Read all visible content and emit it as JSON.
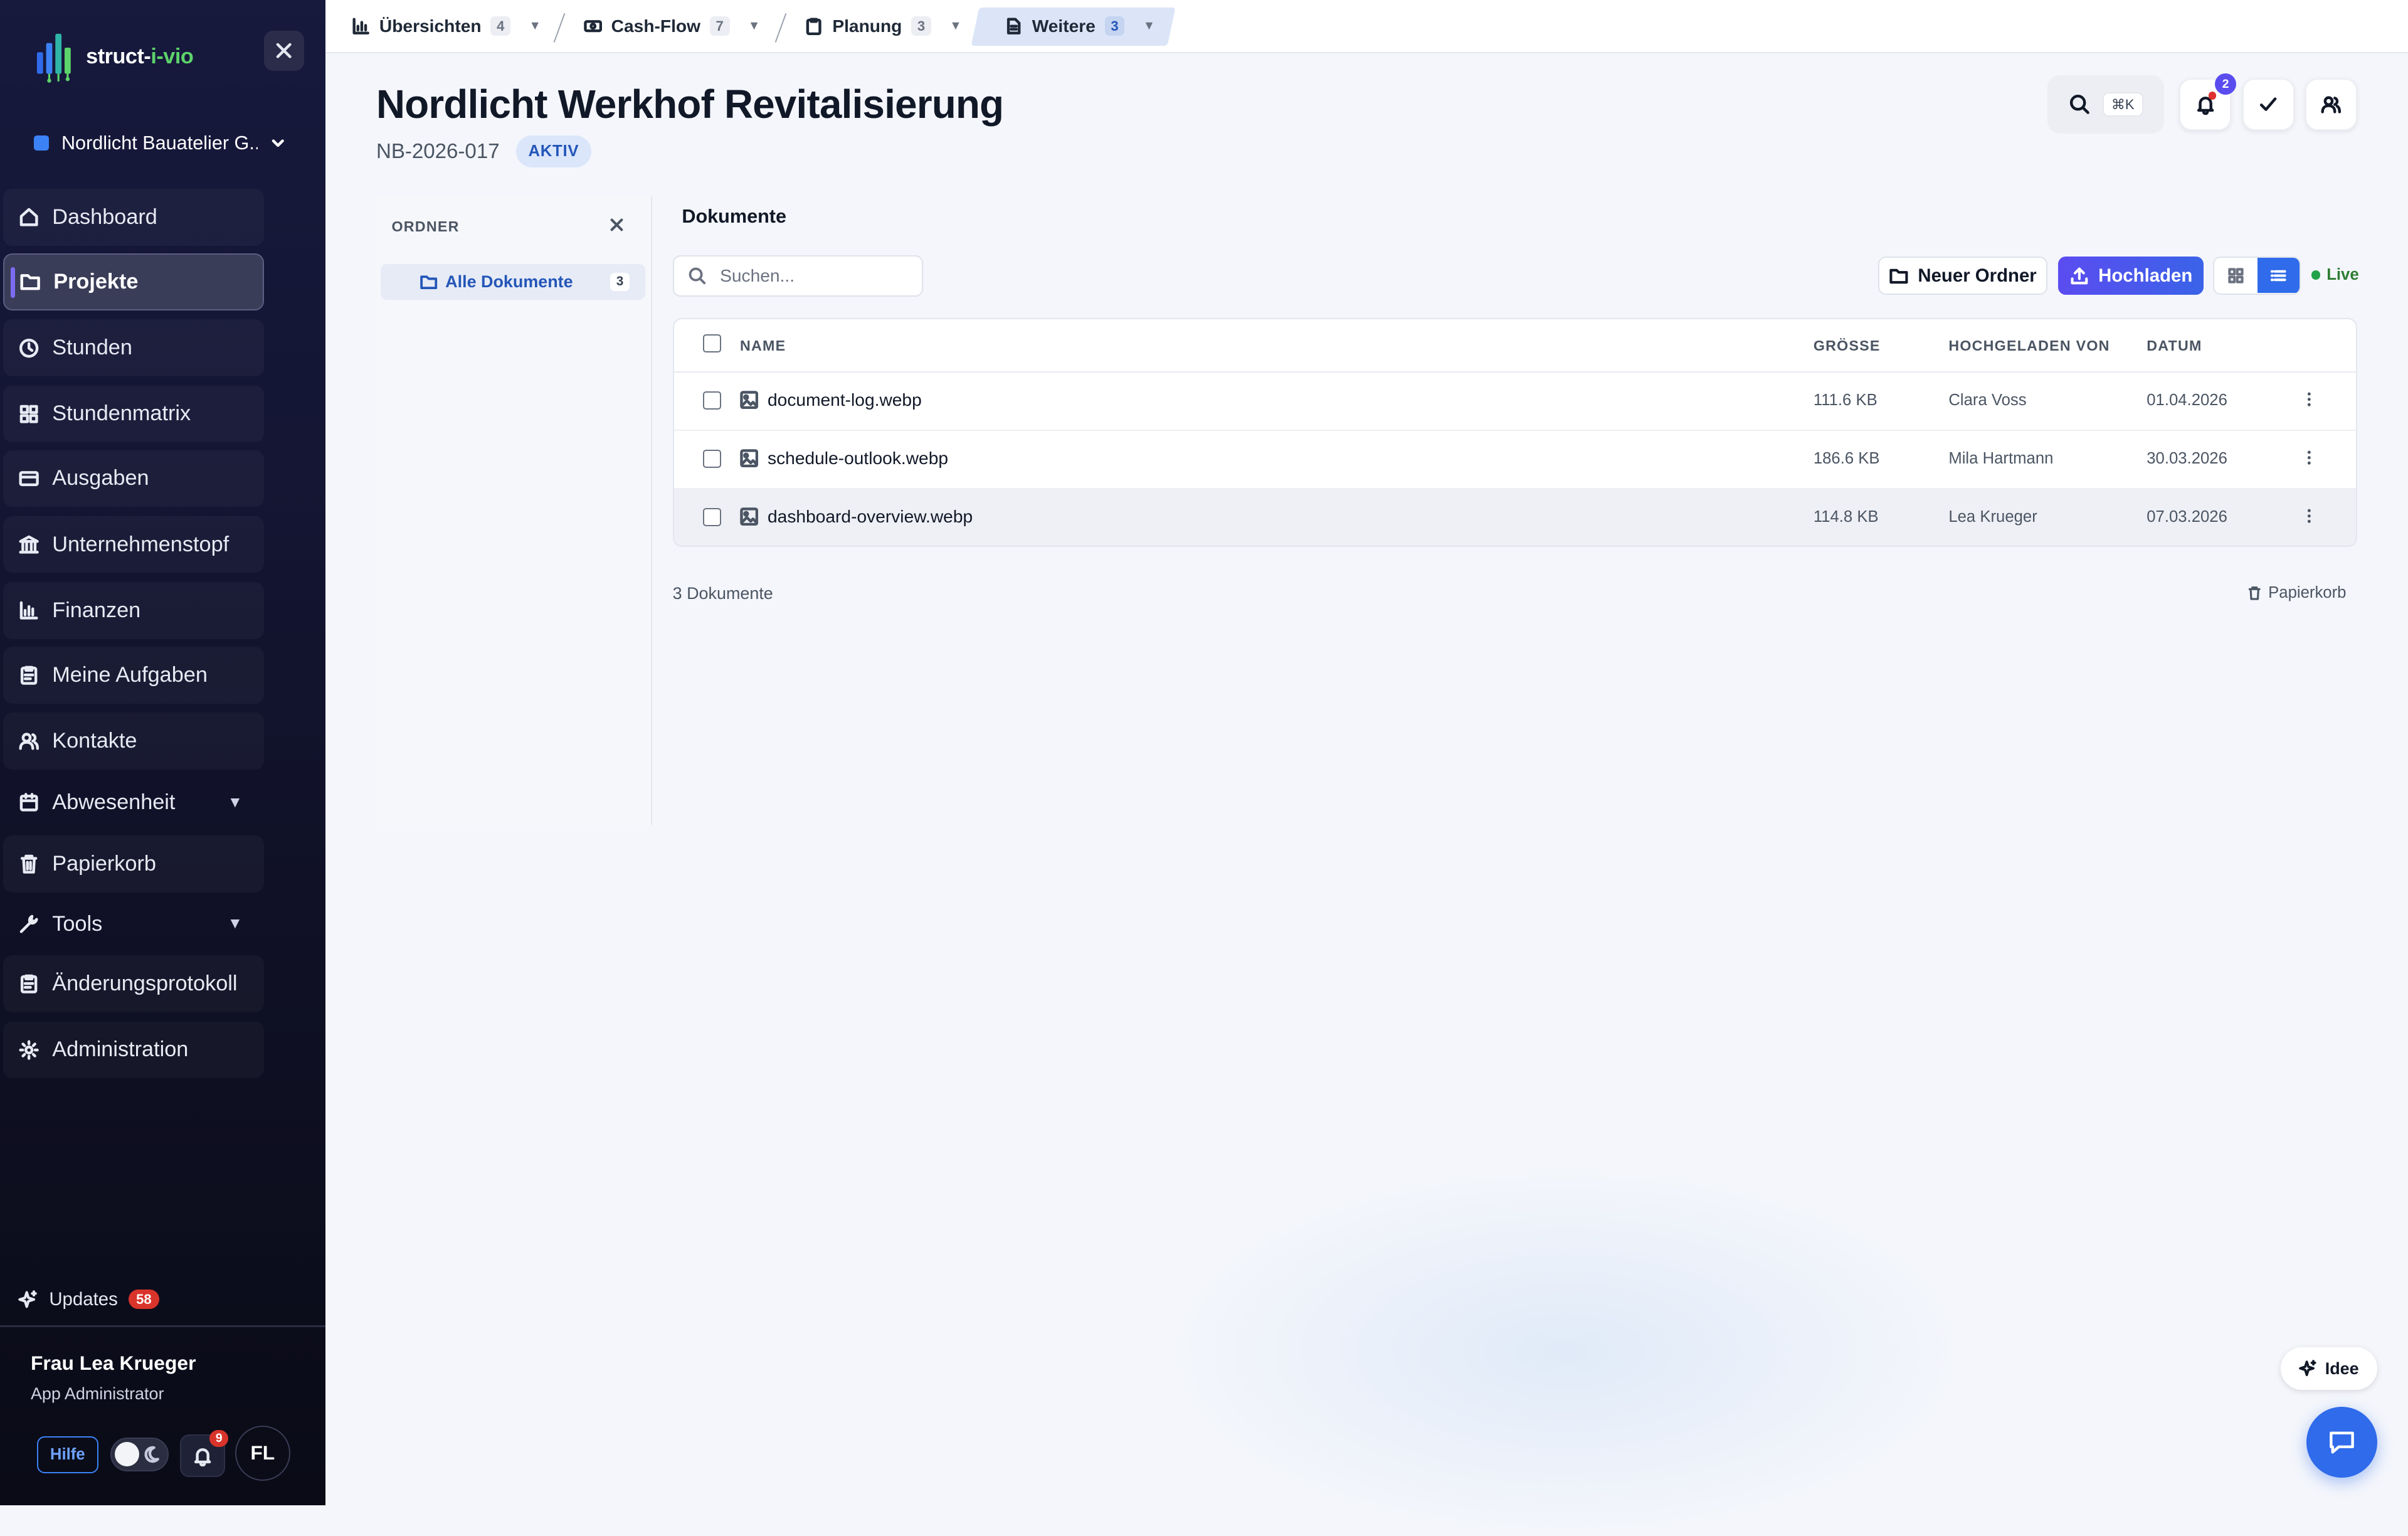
{
  "app": {
    "logo_text_main": "struct-",
    "logo_text_accent": "i-vio",
    "company": "Nordlicht Bauatelier G..."
  },
  "sidebar": {
    "items": [
      {
        "label": "Dashboard",
        "icon": "home-icon"
      },
      {
        "label": "Projekte",
        "icon": "folder-icon",
        "active": true
      },
      {
        "label": "Stunden",
        "icon": "clock-icon"
      },
      {
        "label": "Stundenmatrix",
        "icon": "grid-icon"
      },
      {
        "label": "Ausgaben",
        "icon": "card-icon"
      },
      {
        "label": "Unternehmenstopf",
        "icon": "bank-icon"
      },
      {
        "label": "Finanzen",
        "icon": "chart-icon"
      },
      {
        "label": "Meine Aufgaben",
        "icon": "clipboard-icon"
      },
      {
        "label": "Kontakte",
        "icon": "users-icon"
      },
      {
        "label": "Abwesenheit",
        "icon": "calendar-icon",
        "expandable": true
      },
      {
        "label": "Papierkorb",
        "icon": "trash-icon"
      },
      {
        "label": "Tools",
        "icon": "wrench-icon",
        "expandable": true
      },
      {
        "label": "Änderungsprotokoll",
        "icon": "clipboard-icon"
      },
      {
        "label": "Administration",
        "icon": "gear-icon"
      }
    ],
    "updates_label": "Updates",
    "updates_count": "58",
    "user_name": "Frau Lea Krueger",
    "user_role": "App Administrator",
    "help_label": "Hilfe",
    "notif_count": "9",
    "avatar_initials": "FL"
  },
  "tabs": [
    {
      "label": "Übersichten",
      "count": "4",
      "icon": "bar-chart-icon"
    },
    {
      "label": "Cash-Flow",
      "count": "7",
      "icon": "banknote-icon"
    },
    {
      "label": "Planung",
      "count": "3",
      "icon": "clipboard-icon"
    },
    {
      "label": "Weitere",
      "count": "3",
      "icon": "document-icon",
      "active": true
    }
  ],
  "header": {
    "title": "Nordlicht Werkhof Revitalisierung",
    "code": "NB-2026-017",
    "status": "AKTIV",
    "search_shortcut": "⌘K",
    "notif_count": "2"
  },
  "folders": {
    "heading": "ORDNER",
    "items": [
      {
        "label": "Alle Dokumente",
        "count": "3"
      }
    ]
  },
  "documents": {
    "title": "Dokumente",
    "search_placeholder": "Suchen...",
    "new_folder_label": "Neuer Ordner",
    "upload_label": "Hochladen",
    "live_label": "Live",
    "columns": {
      "name": "NAME",
      "size": "GRÖSSE",
      "uploaded_by": "HOCHGELADEN VON",
      "date": "DATUM"
    },
    "rows": [
      {
        "name": "document-log.webp",
        "size": "111.6 KB",
        "uploaded_by": "Clara Voss",
        "date": "01.04.2026"
      },
      {
        "name": "schedule-outlook.webp",
        "size": "186.6 KB",
        "uploaded_by": "Mila Hartmann",
        "date": "30.03.2026"
      },
      {
        "name": "dashboard-overview.webp",
        "size": "114.8 KB",
        "uploaded_by": "Lea Krueger",
        "date": "07.03.2026"
      }
    ],
    "count_label": "3 Dokumente",
    "trash_label": "Papierkorb"
  },
  "floating": {
    "idea_label": "Idee"
  },
  "colors": {
    "accent": "#2f6bea",
    "upload_gradient_start": "#5b4cf0",
    "status_badge_bg": "#dbe6fb",
    "live_green": "#22a34a",
    "badge_red": "#d9342b"
  }
}
